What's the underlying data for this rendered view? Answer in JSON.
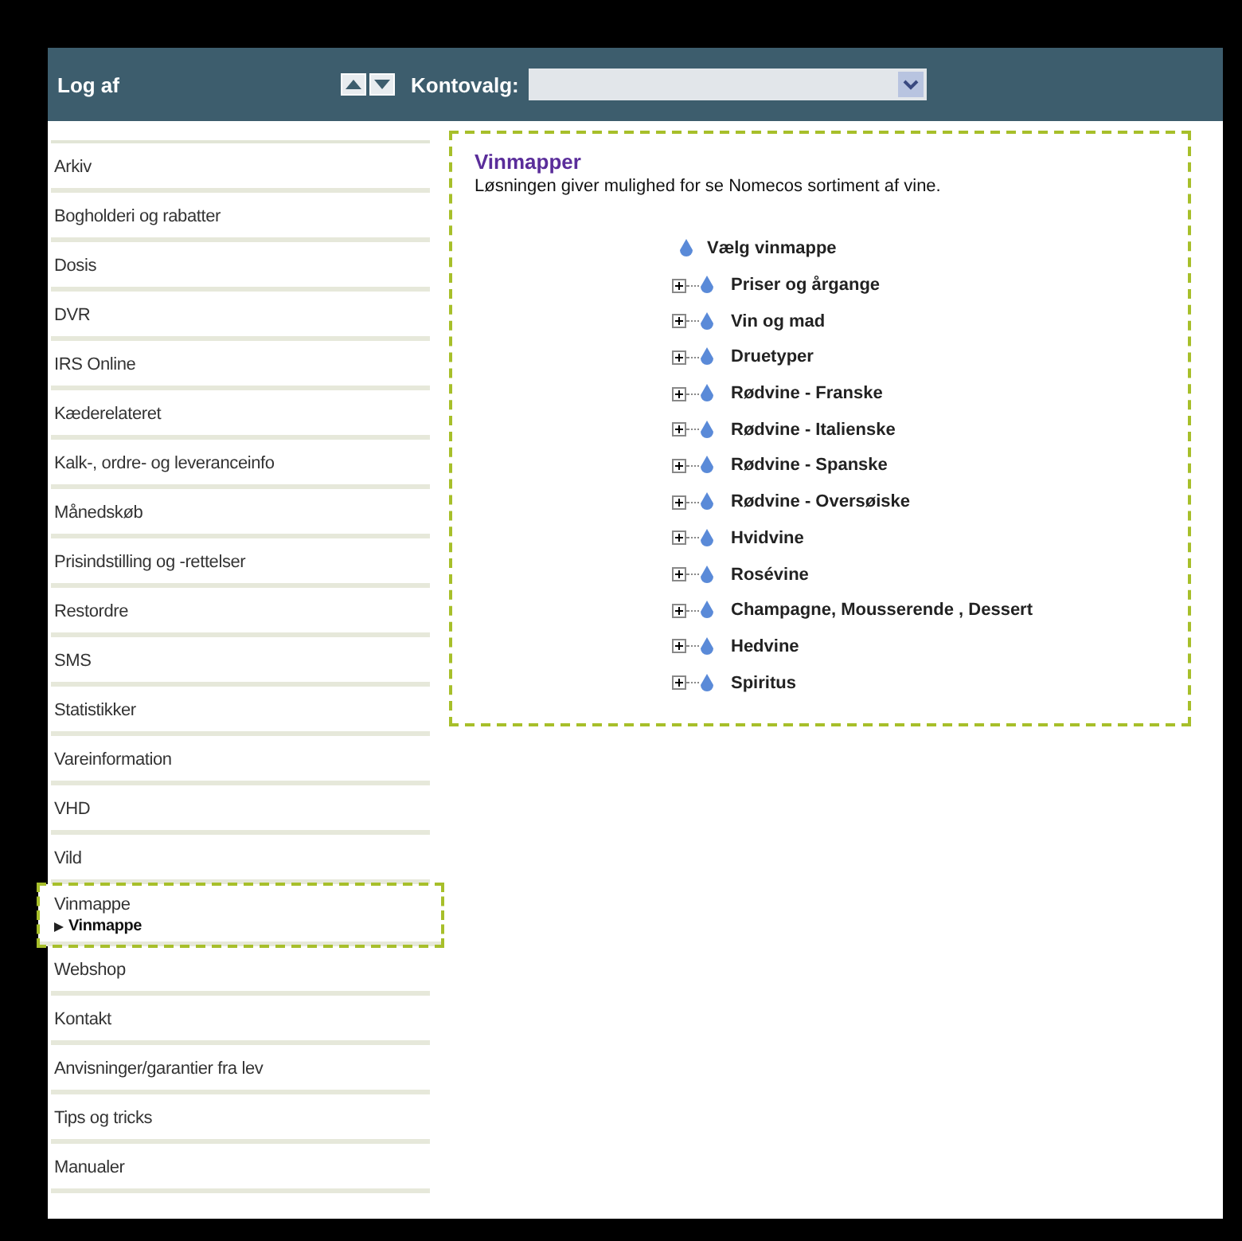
{
  "header": {
    "logout": "Log af",
    "account_label": "Kontovalg:"
  },
  "sidebar": {
    "items": [
      {
        "label": "Arkiv",
        "selected": false
      },
      {
        "label": "Bogholderi og rabatter",
        "selected": false
      },
      {
        "label": "Dosis",
        "selected": false
      },
      {
        "label": "DVR",
        "selected": false
      },
      {
        "label": "IRS Online",
        "selected": false
      },
      {
        "label": "Kæderelateret",
        "selected": false
      },
      {
        "label": "Kalk-, ordre- og leveranceinfo",
        "selected": false
      },
      {
        "label": "Månedskøb",
        "selected": false
      },
      {
        "label": "Prisindstilling og -rettelser",
        "selected": false
      },
      {
        "label": "Restordre",
        "selected": false
      },
      {
        "label": "SMS",
        "selected": false
      },
      {
        "label": "Statistikker",
        "selected": false
      },
      {
        "label": "Vareinformation",
        "selected": false
      },
      {
        "label": "VHD",
        "selected": false
      },
      {
        "label": "Vild",
        "selected": false
      },
      {
        "label": "Vinmappe",
        "selected": true,
        "children": [
          {
            "label": "Vinmappe"
          }
        ]
      },
      {
        "label": "Webshop",
        "selected": false
      },
      {
        "label": "Kontakt",
        "selected": false
      },
      {
        "label": "Anvisninger/garantier fra lev",
        "selected": false
      },
      {
        "label": "Tips og tricks",
        "selected": false
      },
      {
        "label": "Manualer",
        "selected": false
      }
    ]
  },
  "content": {
    "title": "Vinmapper",
    "description": "Løsningen giver mulighed for se Nomecos sortiment af vine.",
    "tree": {
      "label": "Vælg vinmappe",
      "children": [
        {
          "label": "Priser og årgange",
          "expanded": false
        },
        {
          "label": "Vin og mad",
          "expanded": false
        },
        {
          "label": "Druetyper",
          "expanded": false
        },
        {
          "label": "Rødvine - Franske",
          "expanded": false
        },
        {
          "label": "Rødvine - Italienske",
          "expanded": false
        },
        {
          "label": "Rødvine - Spanske",
          "expanded": false
        },
        {
          "label": "Rødvine - Oversøiske",
          "expanded": false
        },
        {
          "label": "Hvidvine",
          "expanded": false
        },
        {
          "label": "Rosévine",
          "expanded": false
        },
        {
          "label": "Champagne, Mousserende , Dessert",
          "expanded": false
        },
        {
          "label": "Hedvine",
          "expanded": false
        },
        {
          "label": "Spiritus",
          "expanded": false
        }
      ]
    }
  }
}
